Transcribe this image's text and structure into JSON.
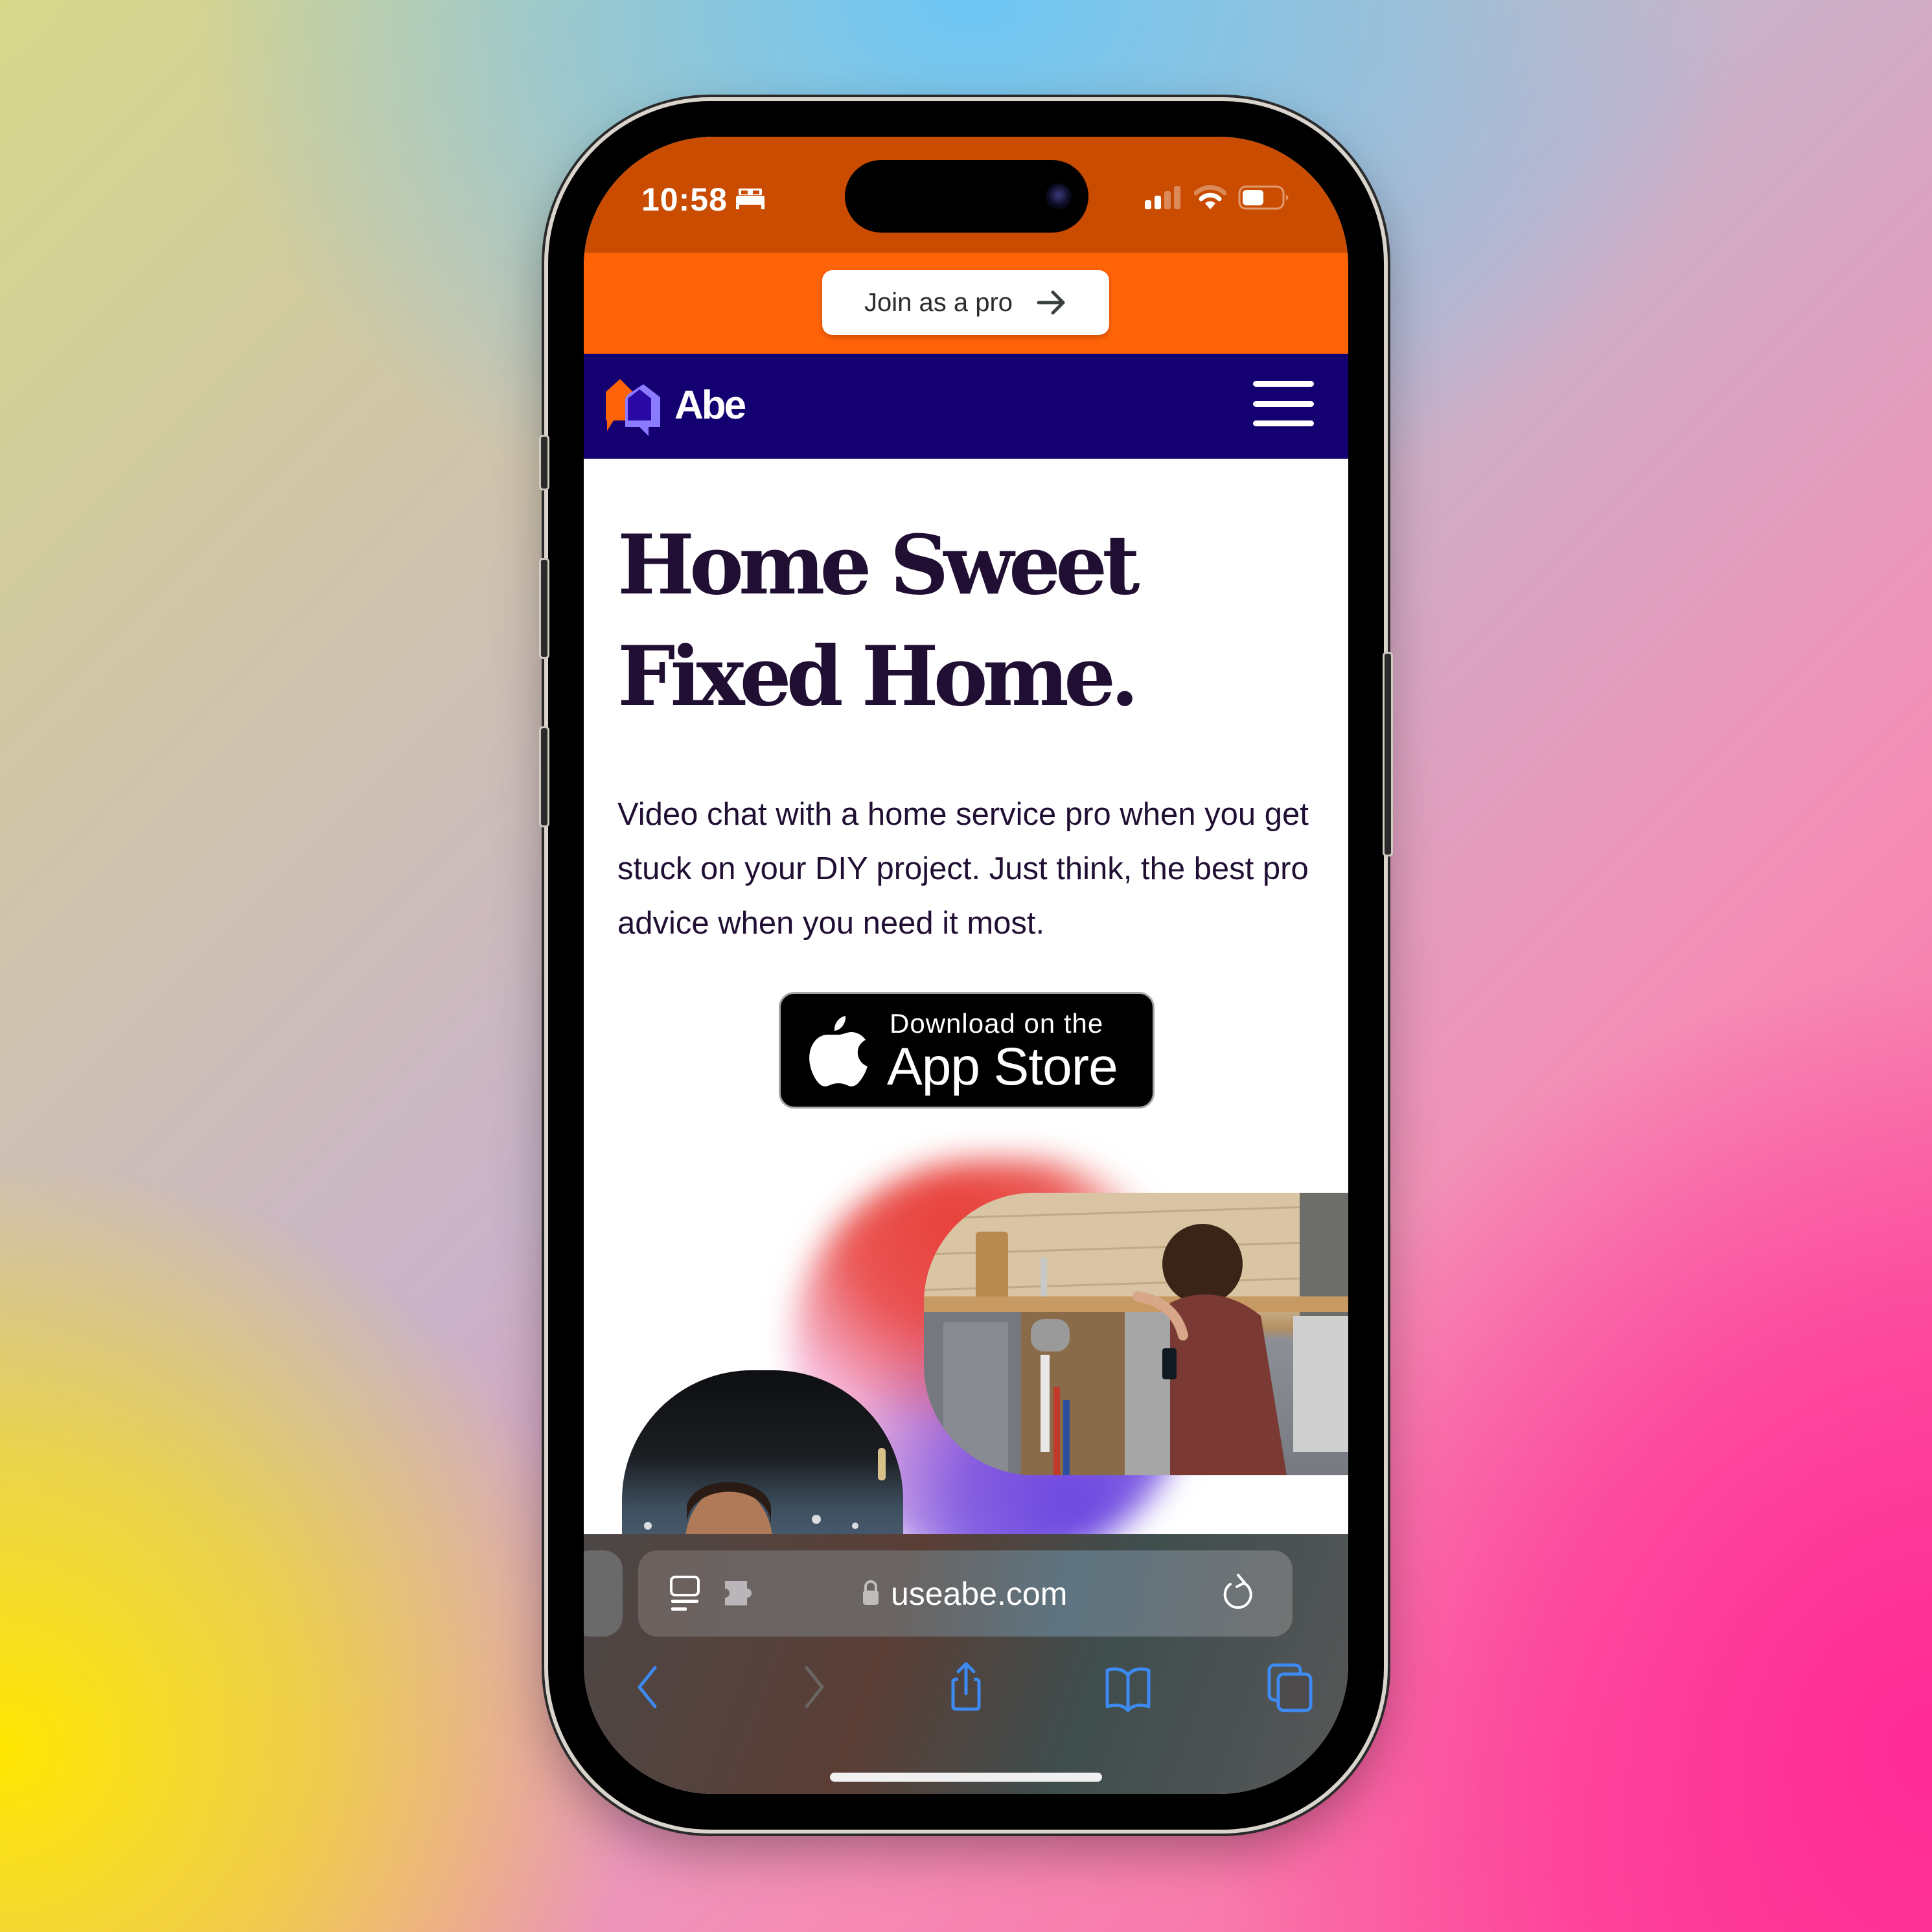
{
  "status_bar": {
    "time": "10:58",
    "focus_icon": "bed-icon",
    "signal_bars_active": 2,
    "signal_bars_total": 4,
    "wifi_arcs_active": 2,
    "wifi_arcs_total": 3,
    "battery_level_percent": 50
  },
  "promo_banner": {
    "join_label": "Join as a pro",
    "join_icon": "arrow-right-icon",
    "background": "#FF6308"
  },
  "nav": {
    "brand": "Abe",
    "logo_icon": "abe-house-chat-logo",
    "menu_icon": "hamburger-menu-icon",
    "background": "#140071"
  },
  "hero": {
    "headline_line1": "Home Sweet",
    "headline_line2": "Fixed Home.",
    "body": "Video chat with a home service pro when you get stuck on your DIY project. Just think, the best pro advice when you need it most.",
    "text_color": "#200F33"
  },
  "app_store_badge": {
    "line1": "Download on the",
    "line2": "App Store",
    "icon": "apple-logo-icon"
  },
  "images": {
    "kitchen_photo": "woman inspecting under-sink cabinet with phone",
    "pro_photo": "smiling man portrait"
  },
  "safari": {
    "url": "useabe.com",
    "lock_icon": "lock-icon",
    "reader_icon": "page-format-icon",
    "extension_icon": "puzzle-extension-icon",
    "reload_icon": "reload-icon",
    "toolbar": [
      {
        "name": "back-button",
        "icon": "chevron-left-icon",
        "enabled": true
      },
      {
        "name": "forward-button",
        "icon": "chevron-right-icon",
        "enabled": false
      },
      {
        "name": "share-button",
        "icon": "share-icon",
        "enabled": true
      },
      {
        "name": "bookmarks-button",
        "icon": "book-icon",
        "enabled": true
      },
      {
        "name": "tabs-button",
        "icon": "tabs-icon",
        "enabled": true
      }
    ],
    "accent": "#3D8BF2"
  }
}
